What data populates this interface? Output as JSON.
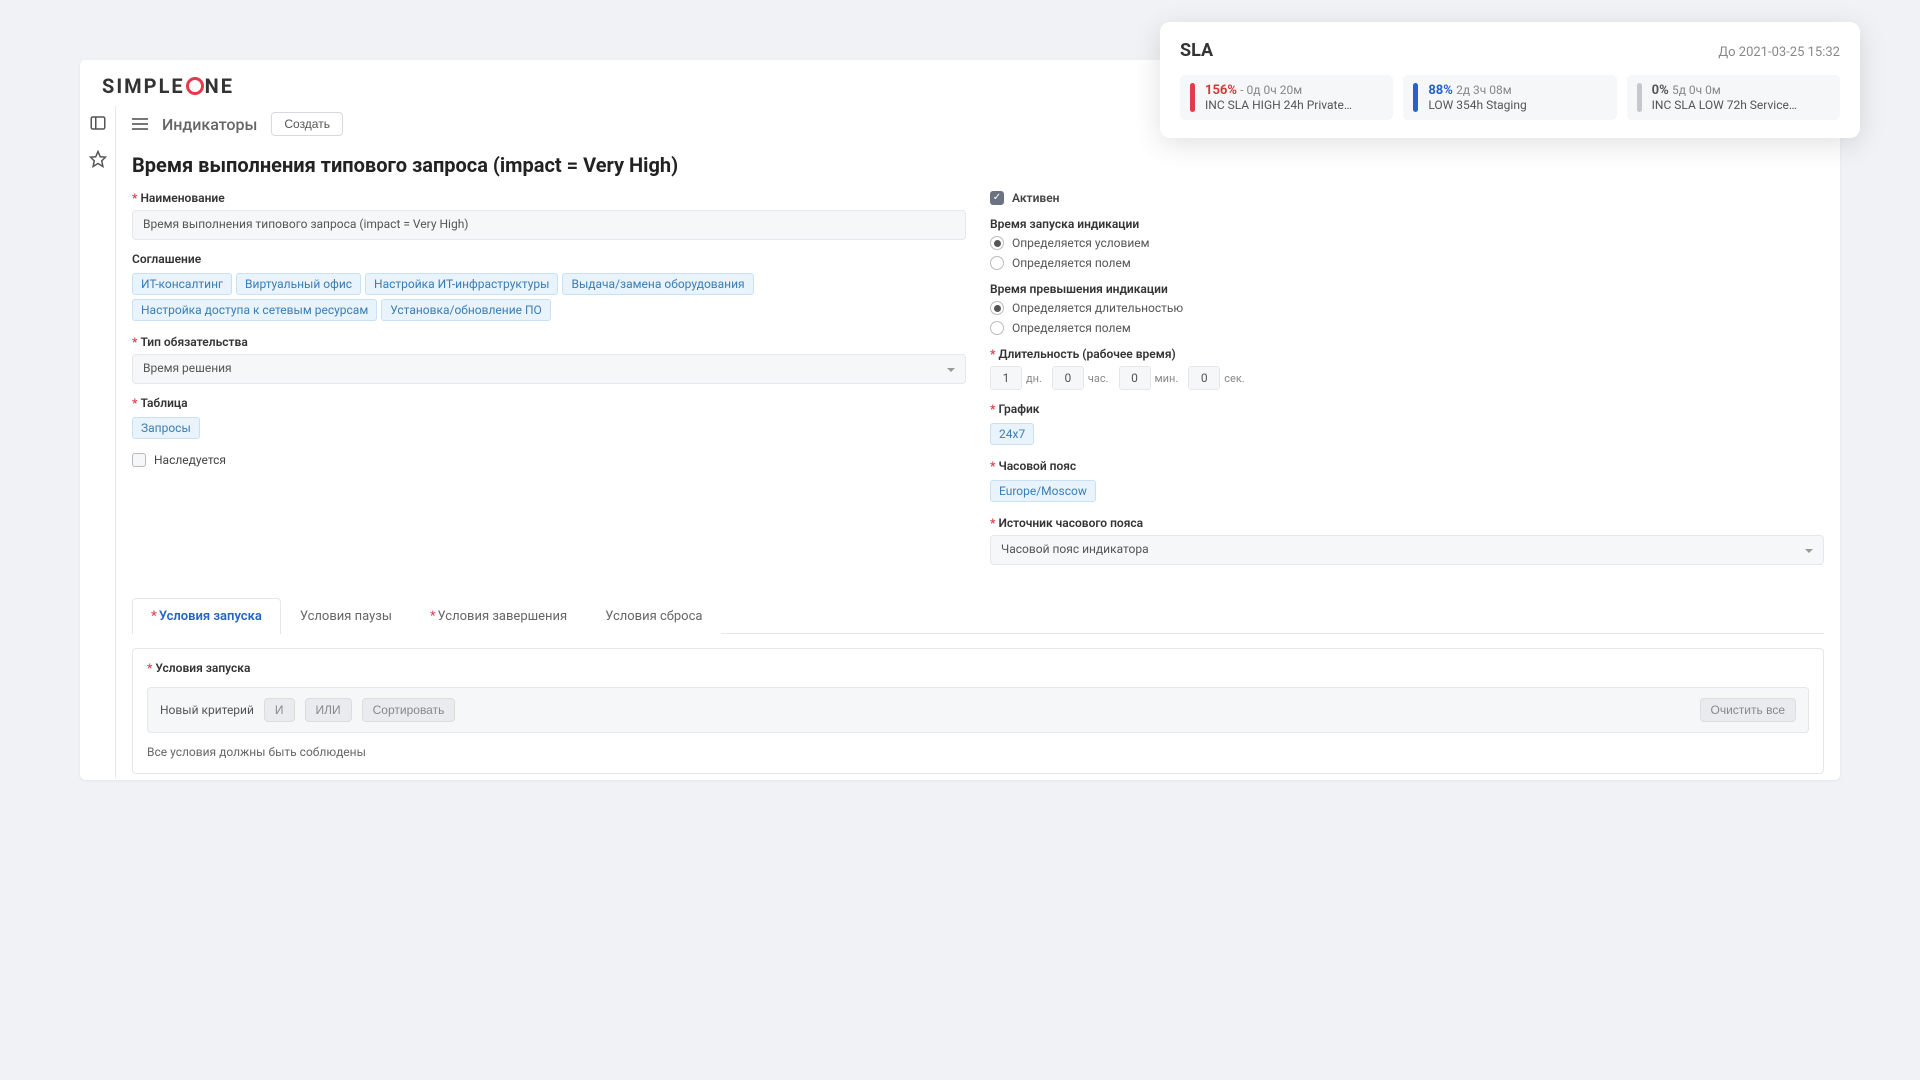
{
  "logo": {
    "pre": "SIMPLE",
    "post": "NE"
  },
  "header": {
    "crumb": "Индикаторы",
    "create": "Создать"
  },
  "page_title": "Время выполнения типового запроса (impact = Very High)",
  "left": {
    "name_label": "Наименование",
    "name_value": "Время выполнения типового запроса (impact = Very High)",
    "agreement_label": "Соглашение",
    "agreement_chips": [
      "ИТ-консалтинг",
      "Виртуальный офис",
      "Настройка ИТ-инфраструктуры",
      "Выдача/замена оборудования",
      "Настройка доступа к сетевым ресурсам",
      "Установка/обновление ПО"
    ],
    "obligation_label": "Тип обязательства",
    "obligation_value": "Время решения",
    "table_label": "Таблица",
    "table_chip": "Запросы",
    "inherited_label": "Наследуется"
  },
  "right": {
    "active_label": "Активен",
    "start_time_label": "Время запуска индикации",
    "start_opt1": "Определяется условием",
    "start_opt2": "Определяется полем",
    "exceed_time_label": "Время превышения индикации",
    "exceed_opt1": "Определяется длительностью",
    "exceed_opt2": "Определяется полем",
    "duration_label": "Длительность (рабочее время)",
    "duration": {
      "d": "1",
      "d_lbl": "дн.",
      "h": "0",
      "h_lbl": "час.",
      "m": "0",
      "m_lbl": "мин.",
      "s": "0",
      "s_lbl": "сек."
    },
    "schedule_label": "График",
    "schedule_chip": "24x7",
    "tz_label": "Часовой пояс",
    "tz_chip": "Europe/Moscow",
    "tz_source_label": "Источник часового пояса",
    "tz_source_value": "Часовой пояс индикатора"
  },
  "tabs": {
    "t1": "Условия запуска",
    "t2": "Условия паузы",
    "t3": "Условия завершения",
    "t4": "Условия сброса"
  },
  "panel": {
    "head": "Условия запуска",
    "new_crit": "Новый критерий",
    "and": "И",
    "or": "ИЛИ",
    "sort": "Сортировать",
    "clear": "Очистить все",
    "note": "Все условия должны быть соблюдены"
  },
  "sla": {
    "title": "SLA",
    "until": "До 2021-03-25 15:32",
    "items": [
      {
        "pct": "156%",
        "time": "- 0д 0ч 20м",
        "desc": "INC SLA HIGH 24h Private…",
        "color": "red"
      },
      {
        "pct": "88%",
        "time": "2д 3ч 08м",
        "desc": "LOW 354h Staging",
        "color": "blue"
      },
      {
        "pct": "0%",
        "time": "5д 0ч 0м",
        "desc": "INC SLA LOW 72h Service…",
        "color": "gray"
      }
    ]
  }
}
